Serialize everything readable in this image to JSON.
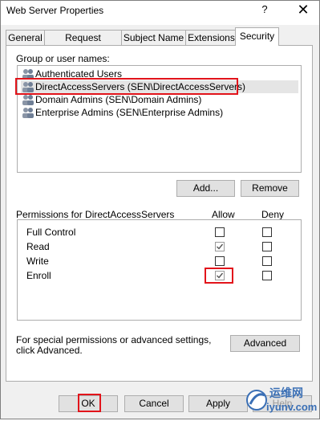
{
  "window": {
    "title": "Web Server Properties",
    "help": "?",
    "close": "✕"
  },
  "tabs": [
    {
      "label": "General"
    },
    {
      "label": "Request Handling"
    },
    {
      "label": "Subject Name"
    },
    {
      "label": "Extensions"
    },
    {
      "label": "Security",
      "active": true
    }
  ],
  "group": {
    "heading": "Group or user names:",
    "users": [
      {
        "name": "Authenticated Users"
      },
      {
        "name": "DirectAccessServers (SEN\\DirectAccessServers)",
        "selected": true
      },
      {
        "name": "Domain Admins (SEN\\Domain Admins)"
      },
      {
        "name": "Enterprise Admins (SEN\\Enterprise Admins)"
      }
    ],
    "add_label": "Add...",
    "remove_label": "Remove"
  },
  "permissions": {
    "heading": "Permissions for DirectAccessServers",
    "allow_label": "Allow",
    "deny_label": "Deny",
    "rows": [
      {
        "name": "Full Control",
        "allow": false,
        "deny": false
      },
      {
        "name": "Read",
        "allow": true,
        "deny": false
      },
      {
        "name": "Write",
        "allow": false,
        "deny": false
      },
      {
        "name": "Enroll",
        "allow": true,
        "deny": false
      }
    ]
  },
  "advanced": {
    "text": "For special permissions or advanced settings, click Advanced.",
    "button_label": "Advanced"
  },
  "footer": {
    "ok_label": "OK",
    "cancel_label": "Cancel",
    "apply_label": "Apply",
    "help_label": "Help"
  },
  "watermark": {
    "line1": "运维网",
    "line2": "iyunv.com"
  },
  "colors": {
    "highlight": "#e2141b",
    "selection": "#e5e5e5"
  }
}
